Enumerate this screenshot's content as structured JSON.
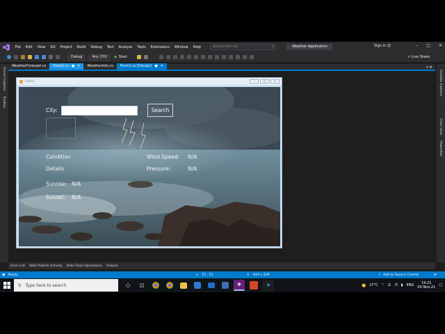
{
  "menubar": {
    "items": [
      "File",
      "Edit",
      "View",
      "Git",
      "Project",
      "Build",
      "Debug",
      "Test",
      "Analyze",
      "Tools",
      "Extensions",
      "Window",
      "Help"
    ],
    "search_placeholder": "Search (Ctrl+Q)",
    "app_name": "Weather Application",
    "sign_in": "Sign in"
  },
  "toolbar": {
    "config": "Debug",
    "platform": "Any CPU",
    "start_label": "Start",
    "live_share": "Live Share"
  },
  "tabs": [
    {
      "label": "WeatherForecast.cs"
    },
    {
      "label": "Form1.cs"
    },
    {
      "label": "WeatherInfo.cs"
    },
    {
      "label": "Form1.cs [Design]"
    }
  ],
  "left_rail": [
    "Server Explorer",
    "Toolbox"
  ],
  "right_rail": [
    "Solution Explorer",
    "Class View",
    "Properties"
  ],
  "form": {
    "title": "Form1",
    "city_label": "City:",
    "city_value": "",
    "search_button": "Search",
    "condition": "Condition",
    "details": "Details",
    "wind_label": "Wind Speed:",
    "wind_value": "N/A",
    "pressure_label": "Pressure:",
    "pressure_value": "N/A",
    "sunrise_label": "Sunrise:",
    "sunrise_value": "N/A",
    "sunset_label": "Sunset:",
    "sunset_value": "N/A"
  },
  "bottom_tabs": [
    "Error List",
    "Web Publish Activity",
    "Data Tools Operations",
    "Output"
  ],
  "statusbar": {
    "ready": "Ready",
    "position": "15 , 15",
    "size": "819 x 529",
    "source_control": "Add to Source Control"
  },
  "taskbar": {
    "search_placeholder": "Type here to search",
    "temperature": "27°C",
    "language": "ENG",
    "time": "19:21",
    "date": "04-Nov-21"
  },
  "colors": {
    "accent": "#007acc",
    "ide_background": "#1e1e1e",
    "chrome": "#2d2d30",
    "vs_purple": "#68217a"
  }
}
